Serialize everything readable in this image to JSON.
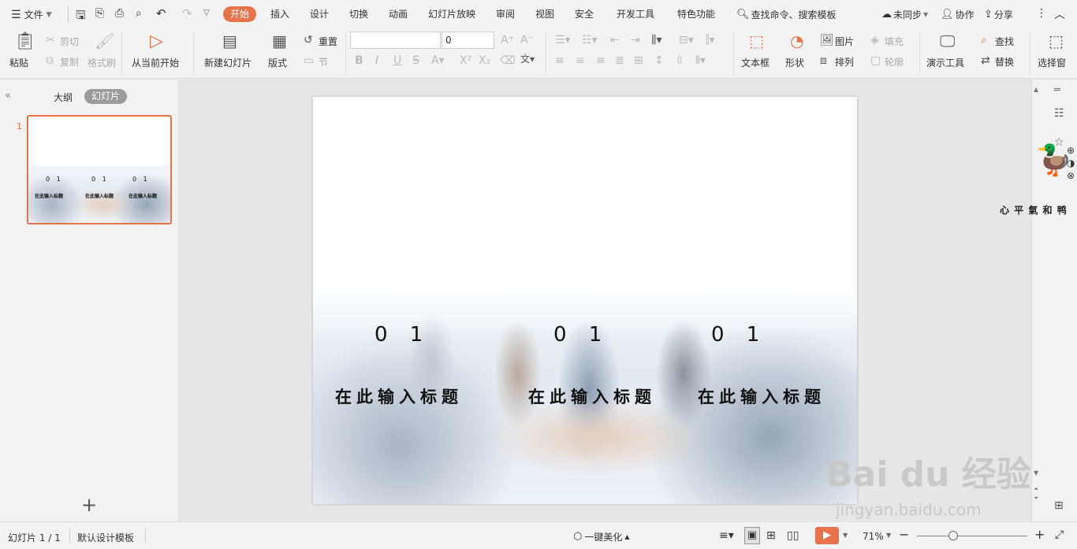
{
  "titlebar": {
    "file_menu": "文件",
    "tabs": [
      "开始",
      "插入",
      "设计",
      "切换",
      "动画",
      "幻灯片放映",
      "审阅",
      "视图",
      "安全",
      "开发工具",
      "特色功能"
    ],
    "active_tab": "开始",
    "search": "查找命令、搜索模板",
    "sync": "未同步",
    "collab": "协作",
    "share": "分享"
  },
  "ribbon": {
    "paste": "粘贴",
    "cut": "剪切",
    "copy": "复制",
    "format_painter": "格式刷",
    "from_current": "从当前开始",
    "new_slide": "新建幻灯片",
    "layout": "版式",
    "reset": "重置",
    "section": "节",
    "font_name": "",
    "font_size": "0",
    "text_box": "文本框",
    "shape": "形状",
    "picture": "图片",
    "fill": "填充",
    "arrange": "排列",
    "outline": "轮廓",
    "present_tools": "演示工具",
    "find": "查找",
    "replace": "替换",
    "select_pane": "选择窗"
  },
  "left_panel": {
    "outline_tab": "大纲",
    "slides_tab": "幻灯片",
    "slide_number": "1",
    "add": "+"
  },
  "slide": {
    "columns": [
      {
        "number": "0 1",
        "title": "在此输入标题"
      },
      {
        "number": "0 1",
        "title": "在此输入标题"
      },
      {
        "number": "0 1",
        "title": "在此输入标题"
      }
    ]
  },
  "thumbnail": {
    "columns": [
      {
        "number": "0 1",
        "title": "在此输入标题"
      },
      {
        "number": "0 1",
        "title": "在此输入标题"
      },
      {
        "number": "0 1",
        "title": "在此输入标题"
      }
    ]
  },
  "statusbar": {
    "slide_pos": "幻灯片 1 / 1",
    "template": "默认设计模板",
    "beautify": "一键美化",
    "zoom": "71%"
  },
  "watermark": {
    "brand": "Bai du 经验",
    "url": "jingyan.baidu.com",
    "sticker_text": "心 平 氣 和 鸭"
  },
  "colors": {
    "accent": "#e8734a"
  }
}
